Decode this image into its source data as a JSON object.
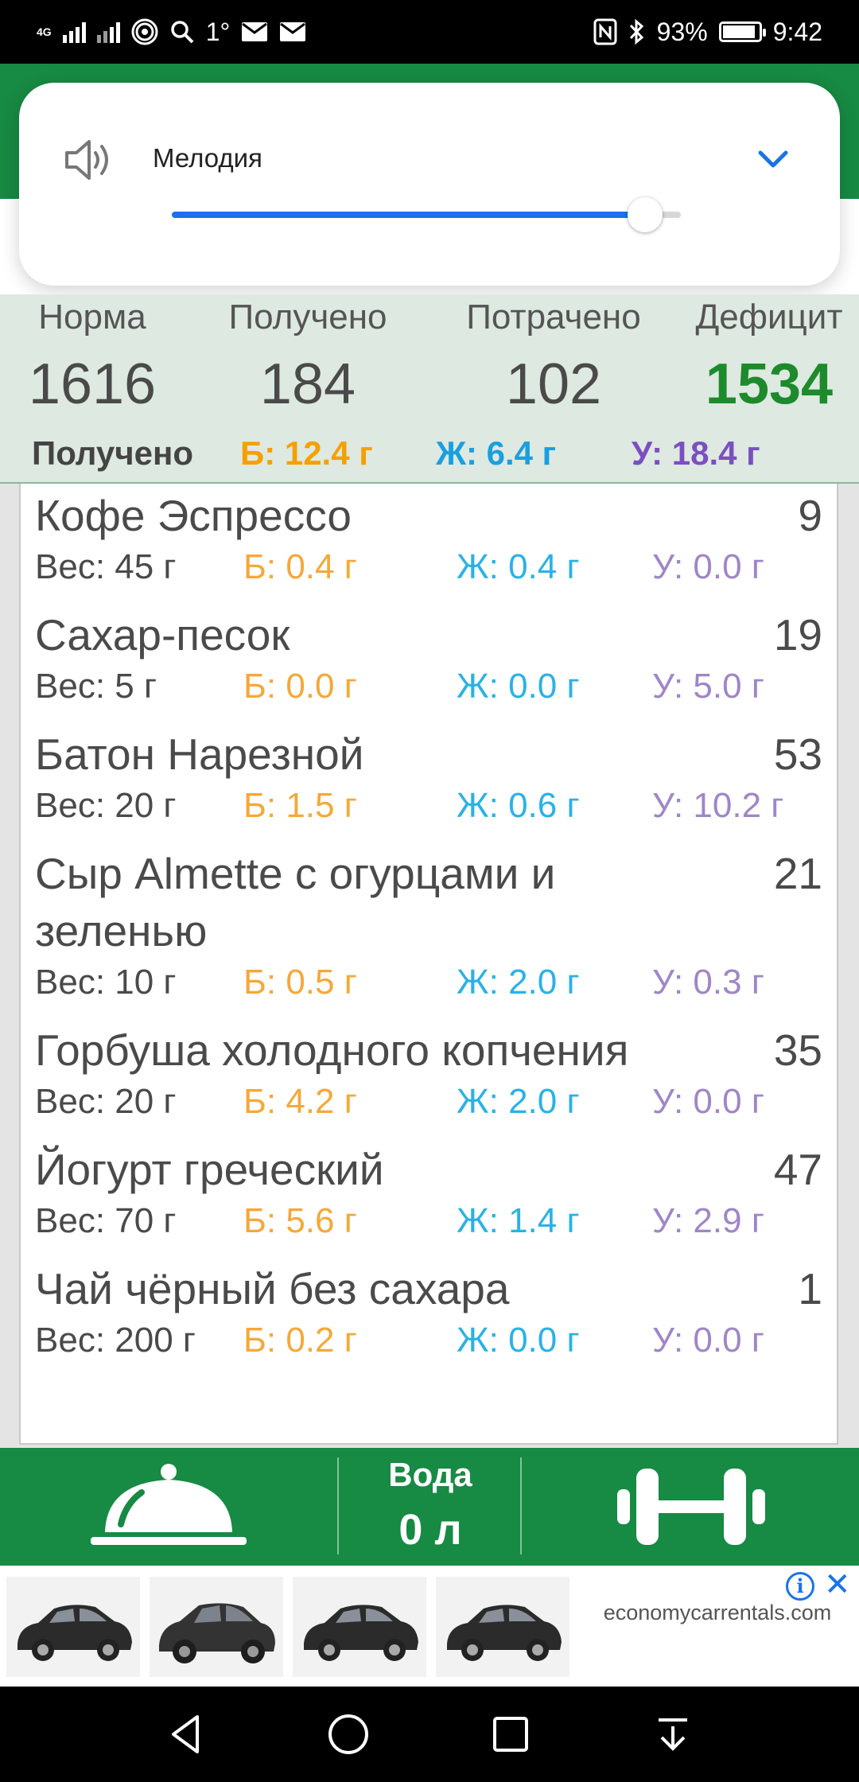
{
  "status_bar": {
    "network": "4G",
    "temperature": "1°",
    "battery": "93%",
    "battery_level": 0.93,
    "time": "9:42"
  },
  "volume_panel": {
    "label": "Мелодия",
    "level": 0.93,
    "icons": [
      "speaker-icon",
      "chevron-down-icon"
    ],
    "accent": "#1a73e8"
  },
  "summary": {
    "norm_label": "Норма",
    "norm_value": "1616",
    "received_label": "Получено",
    "received_value": "184",
    "spent_label": "Потрачено",
    "spent_value": "102",
    "deficit_label": "Дефицит",
    "deficit_value": "1534",
    "macros_label": "Получено",
    "protein": "Б: 12.4 г",
    "fat": "Ж: 6.4 г",
    "carbs": "У: 18.4 г",
    "colors": {
      "deficit": "#1d8a2b",
      "protein": "#f5a000",
      "fat": "#1a9fe0",
      "carbs": "#7b4fc0"
    }
  },
  "foods": [
    {
      "name": "Кофе Эспрессо",
      "kcal": "9",
      "weight": "Вес: 45 г",
      "protein": "Б: 0.4 г",
      "fat": "Ж: 0.4 г",
      "carbs": "У: 0.0 г"
    },
    {
      "name": "Сахар-песок",
      "kcal": "19",
      "weight": "Вес: 5 г",
      "protein": "Б: 0.0 г",
      "fat": "Ж: 0.0 г",
      "carbs": "У: 5.0 г"
    },
    {
      "name": "Батон Нарезной",
      "kcal": "53",
      "weight": "Вес: 20 г",
      "protein": "Б: 1.5 г",
      "fat": "Ж: 0.6 г",
      "carbs": "У: 10.2 г"
    },
    {
      "name": "Сыр Almette с огурцами и зеленью",
      "kcal": "21",
      "weight": "Вес: 10 г",
      "protein": "Б: 0.5 г",
      "fat": "Ж: 2.0 г",
      "carbs": "У: 0.3 г"
    },
    {
      "name": "Горбуша холодного копчения",
      "kcal": "35",
      "weight": "Вес: 20 г",
      "protein": "Б: 4.2 г",
      "fat": "Ж: 2.0 г",
      "carbs": "У: 0.0 г"
    },
    {
      "name": "Йогурт греческий",
      "kcal": "47",
      "weight": "Вес: 70 г",
      "protein": "Б: 5.6 г",
      "fat": "Ж: 1.4 г",
      "carbs": "У: 2.9 г"
    },
    {
      "name": "Чай чёрный без сахара",
      "kcal": "1",
      "weight": "Вес: 200 г",
      "protein": "Б: 0.2 г",
      "fat": "Ж: 0.0 г",
      "carbs": "У: 0.0 г"
    }
  ],
  "bottom_bar": {
    "water_title": "Вода",
    "water_value": "0 л",
    "icons": [
      "meal-cloche-icon",
      "dumbbell-icon"
    ],
    "color": "#178a43"
  },
  "ad": {
    "domain": "economycarrentals.com",
    "icons": [
      "car-image",
      "info-icon",
      "close-icon"
    ]
  },
  "nav_bar": {
    "icons": [
      "back-icon",
      "home-icon",
      "recents-icon",
      "notification-pull-icon"
    ]
  }
}
